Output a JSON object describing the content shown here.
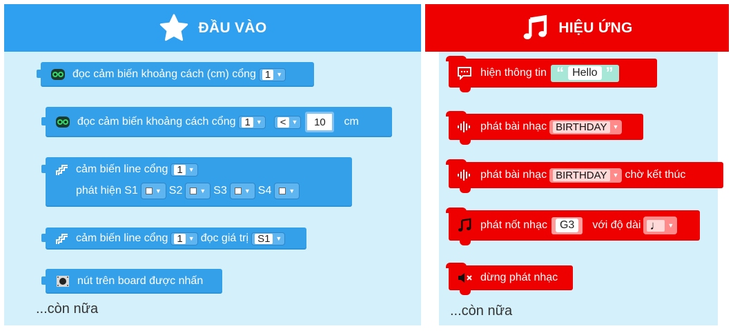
{
  "left_panel": {
    "title": "ĐẦU VÀO",
    "icon": "star-icon",
    "color": "#2f9ff0",
    "blocks": {
      "b1": {
        "text": "đọc cảm biến khoảng cách (cm) cổng",
        "port": "1"
      },
      "b2": {
        "text": "đọc cảm biến khoảng cách cổng",
        "port": "1",
        "op": "<",
        "value": "10",
        "unit": "cm"
      },
      "b3": {
        "text": "cảm biến line cổng",
        "port": "1",
        "detect_label": "phát hiện S1",
        "s2": "S2",
        "s3": "S3",
        "s4": "S4"
      },
      "b4": {
        "text": "cảm biến line cổng",
        "port": "1",
        "read_label": "đọc giá trị",
        "sensor": "S1"
      },
      "b5": {
        "text": "nút trên board được nhấn"
      }
    },
    "more": "...còn nữa"
  },
  "right_panel": {
    "title": "HIỆU ỨNG",
    "icon": "music-note-icon",
    "color": "#ee0000",
    "blocks": {
      "r1": {
        "text": "hiện thông tin",
        "value": "Hello"
      },
      "r2": {
        "text": "phát bài nhạc",
        "song": "BIRTHDAY"
      },
      "r3": {
        "text": "phát bài nhạc",
        "song": "BIRTHDAY",
        "suffix": "chờ kết thúc"
      },
      "r4": {
        "text": "phát nốt nhạc",
        "note": "G3",
        "duration_label": "với độ dài"
      },
      "r5": {
        "text": "dừng phát nhạc"
      }
    },
    "more": "...còn nữa"
  }
}
